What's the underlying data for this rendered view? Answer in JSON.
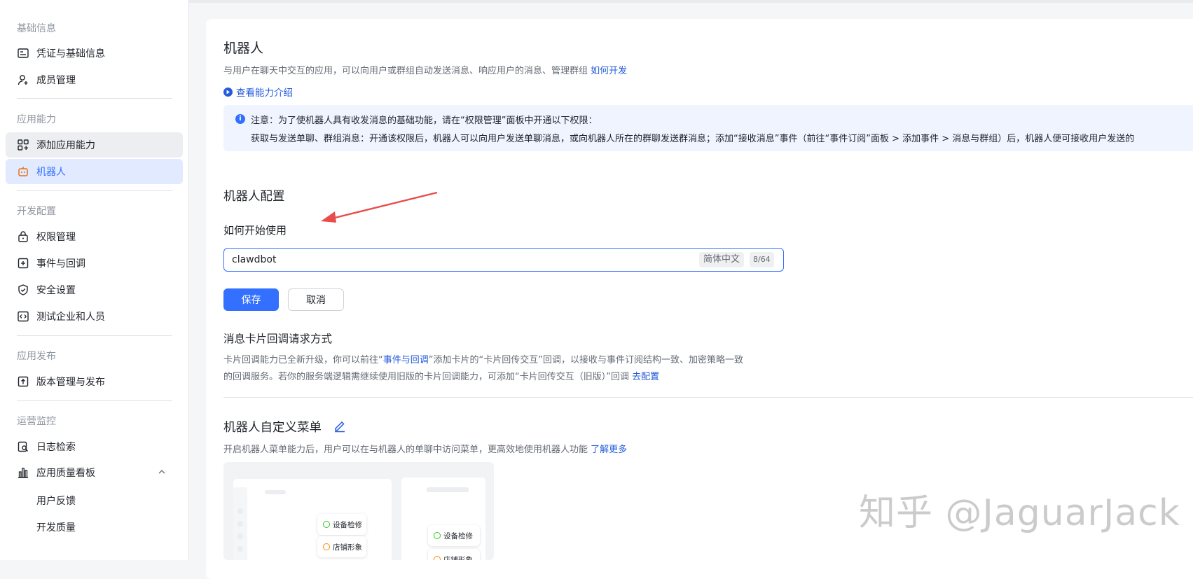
{
  "sidebar": {
    "groups": [
      {
        "title": "基础信息",
        "items": [
          {
            "label": "凭证与基础信息",
            "icon": "credential-icon"
          },
          {
            "label": "成员管理",
            "icon": "add-user-icon"
          }
        ]
      },
      {
        "title": "应用能力",
        "items": [
          {
            "label": "添加应用能力",
            "icon": "apps-add-icon"
          },
          {
            "label": "机器人",
            "icon": "robot-icon"
          }
        ]
      },
      {
        "title": "开发配置",
        "items": [
          {
            "label": "权限管理",
            "icon": "lock-icon"
          },
          {
            "label": "事件与回调",
            "icon": "event-icon"
          },
          {
            "label": "安全设置",
            "icon": "shield-icon"
          },
          {
            "label": "测试企业和人员",
            "icon": "code-icon"
          }
        ]
      },
      {
        "title": "应用发布",
        "items": [
          {
            "label": "版本管理与发布",
            "icon": "upload-icon"
          }
        ]
      },
      {
        "title": "运营监控",
        "items": [
          {
            "label": "日志检索",
            "icon": "log-search-icon"
          },
          {
            "label": "应用质量看板",
            "icon": "chart-icon"
          }
        ],
        "sub_items": [
          "用户反馈",
          "开发质量"
        ]
      }
    ]
  },
  "bot": {
    "title": "机器人",
    "desc": "与用户在聊天中交互的应用，可以向用户或群组自动发送消息、响应用户的消息、管理群组",
    "desc_link": "如何开发",
    "capability_link": "查看能力介绍",
    "notice_line1": "注意：为了使机器人具有收发消息的基础功能，请在“权限管理”面板中开通以下权限：",
    "notice_line2": "获取与发送单聊、群组消息：开通该权限后，机器人可以向用户发送单聊消息，或向机器人所在的群聊发送群消息；添加“接收消息”事件（前往“事件订阅”面板 > 添加事件 > 消息与群组）后，机器人便可接收用户发送的"
  },
  "config": {
    "title": "机器人配置",
    "field_label": "如何开始使用",
    "field_value": "clawdbot",
    "lang_tag": "简体中文",
    "char_count": "8/64",
    "save_label": "保存",
    "cancel_label": "取消"
  },
  "card_callback": {
    "title": "消息卡片回调请求方式",
    "desc_part1": "卡片回调能力已全新升级，你可以前往“",
    "desc_link1": "事件与回调",
    "desc_part2": "”添加卡片的“卡片回传交互”回调，以接收与事件订阅结构一致、加密策略一致",
    "desc_part3": "的回调服务。若你的服务端逻辑需继续使用旧版的卡片回调能力，可添加“卡片回传交互（旧版）”回调 ",
    "desc_link2": "去配置"
  },
  "menu": {
    "title": "机器人自定义菜单",
    "desc": "开启机器人菜单能力后，用户可以在与机器人的单聊中访问菜单，更高效地使用机器人功能 ",
    "desc_link": "了解更多",
    "preview_items": [
      "设备检修",
      "店铺形象",
      "设备检修",
      "店铺形象"
    ]
  },
  "watermark": "知乎 @JaguarJack",
  "colors": {
    "accent": "#3370ff",
    "link": "#245bdb",
    "arrow": "#e84c4c"
  }
}
